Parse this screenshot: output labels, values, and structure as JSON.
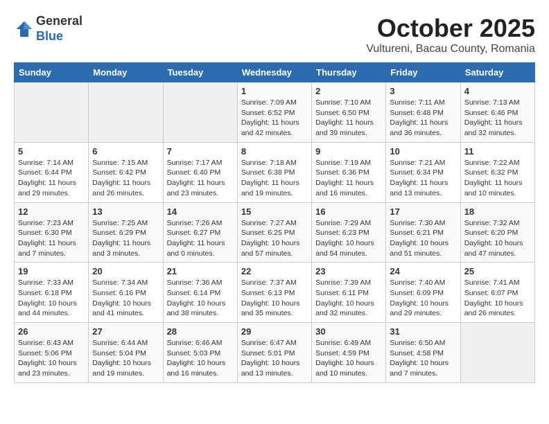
{
  "header": {
    "logo_line1": "General",
    "logo_line2": "Blue",
    "month_title": "October 2025",
    "subtitle": "Vultureni, Bacau County, Romania"
  },
  "days_of_week": [
    "Sunday",
    "Monday",
    "Tuesday",
    "Wednesday",
    "Thursday",
    "Friday",
    "Saturday"
  ],
  "weeks": [
    [
      {
        "day": "",
        "info": ""
      },
      {
        "day": "",
        "info": ""
      },
      {
        "day": "",
        "info": ""
      },
      {
        "day": "1",
        "info": "Sunrise: 7:09 AM\nSunset: 6:52 PM\nDaylight: 11 hours and 42 minutes."
      },
      {
        "day": "2",
        "info": "Sunrise: 7:10 AM\nSunset: 6:50 PM\nDaylight: 11 hours and 39 minutes."
      },
      {
        "day": "3",
        "info": "Sunrise: 7:11 AM\nSunset: 6:48 PM\nDaylight: 11 hours and 36 minutes."
      },
      {
        "day": "4",
        "info": "Sunrise: 7:13 AM\nSunset: 6:46 PM\nDaylight: 11 hours and 32 minutes."
      }
    ],
    [
      {
        "day": "5",
        "info": "Sunrise: 7:14 AM\nSunset: 6:44 PM\nDaylight: 11 hours and 29 minutes."
      },
      {
        "day": "6",
        "info": "Sunrise: 7:15 AM\nSunset: 6:42 PM\nDaylight: 11 hours and 26 minutes."
      },
      {
        "day": "7",
        "info": "Sunrise: 7:17 AM\nSunset: 6:40 PM\nDaylight: 11 hours and 23 minutes."
      },
      {
        "day": "8",
        "info": "Sunrise: 7:18 AM\nSunset: 6:38 PM\nDaylight: 11 hours and 19 minutes."
      },
      {
        "day": "9",
        "info": "Sunrise: 7:19 AM\nSunset: 6:36 PM\nDaylight: 11 hours and 16 minutes."
      },
      {
        "day": "10",
        "info": "Sunrise: 7:21 AM\nSunset: 6:34 PM\nDaylight: 11 hours and 13 minutes."
      },
      {
        "day": "11",
        "info": "Sunrise: 7:22 AM\nSunset: 6:32 PM\nDaylight: 11 hours and 10 minutes."
      }
    ],
    [
      {
        "day": "12",
        "info": "Sunrise: 7:23 AM\nSunset: 6:30 PM\nDaylight: 11 hours and 7 minutes."
      },
      {
        "day": "13",
        "info": "Sunrise: 7:25 AM\nSunset: 6:29 PM\nDaylight: 11 hours and 3 minutes."
      },
      {
        "day": "14",
        "info": "Sunrise: 7:26 AM\nSunset: 6:27 PM\nDaylight: 11 hours and 0 minutes."
      },
      {
        "day": "15",
        "info": "Sunrise: 7:27 AM\nSunset: 6:25 PM\nDaylight: 10 hours and 57 minutes."
      },
      {
        "day": "16",
        "info": "Sunrise: 7:29 AM\nSunset: 6:23 PM\nDaylight: 10 hours and 54 minutes."
      },
      {
        "day": "17",
        "info": "Sunrise: 7:30 AM\nSunset: 6:21 PM\nDaylight: 10 hours and 51 minutes."
      },
      {
        "day": "18",
        "info": "Sunrise: 7:32 AM\nSunset: 6:20 PM\nDaylight: 10 hours and 47 minutes."
      }
    ],
    [
      {
        "day": "19",
        "info": "Sunrise: 7:33 AM\nSunset: 6:18 PM\nDaylight: 10 hours and 44 minutes."
      },
      {
        "day": "20",
        "info": "Sunrise: 7:34 AM\nSunset: 6:16 PM\nDaylight: 10 hours and 41 minutes."
      },
      {
        "day": "21",
        "info": "Sunrise: 7:36 AM\nSunset: 6:14 PM\nDaylight: 10 hours and 38 minutes."
      },
      {
        "day": "22",
        "info": "Sunrise: 7:37 AM\nSunset: 6:13 PM\nDaylight: 10 hours and 35 minutes."
      },
      {
        "day": "23",
        "info": "Sunrise: 7:39 AM\nSunset: 6:11 PM\nDaylight: 10 hours and 32 minutes."
      },
      {
        "day": "24",
        "info": "Sunrise: 7:40 AM\nSunset: 6:09 PM\nDaylight: 10 hours and 29 minutes."
      },
      {
        "day": "25",
        "info": "Sunrise: 7:41 AM\nSunset: 6:07 PM\nDaylight: 10 hours and 26 minutes."
      }
    ],
    [
      {
        "day": "26",
        "info": "Sunrise: 6:43 AM\nSunset: 5:06 PM\nDaylight: 10 hours and 23 minutes."
      },
      {
        "day": "27",
        "info": "Sunrise: 6:44 AM\nSunset: 5:04 PM\nDaylight: 10 hours and 19 minutes."
      },
      {
        "day": "28",
        "info": "Sunrise: 6:46 AM\nSunset: 5:03 PM\nDaylight: 10 hours and 16 minutes."
      },
      {
        "day": "29",
        "info": "Sunrise: 6:47 AM\nSunset: 5:01 PM\nDaylight: 10 hours and 13 minutes."
      },
      {
        "day": "30",
        "info": "Sunrise: 6:49 AM\nSunset: 4:59 PM\nDaylight: 10 hours and 10 minutes."
      },
      {
        "day": "31",
        "info": "Sunrise: 6:50 AM\nSunset: 4:58 PM\nDaylight: 10 hours and 7 minutes."
      },
      {
        "day": "",
        "info": ""
      }
    ]
  ]
}
